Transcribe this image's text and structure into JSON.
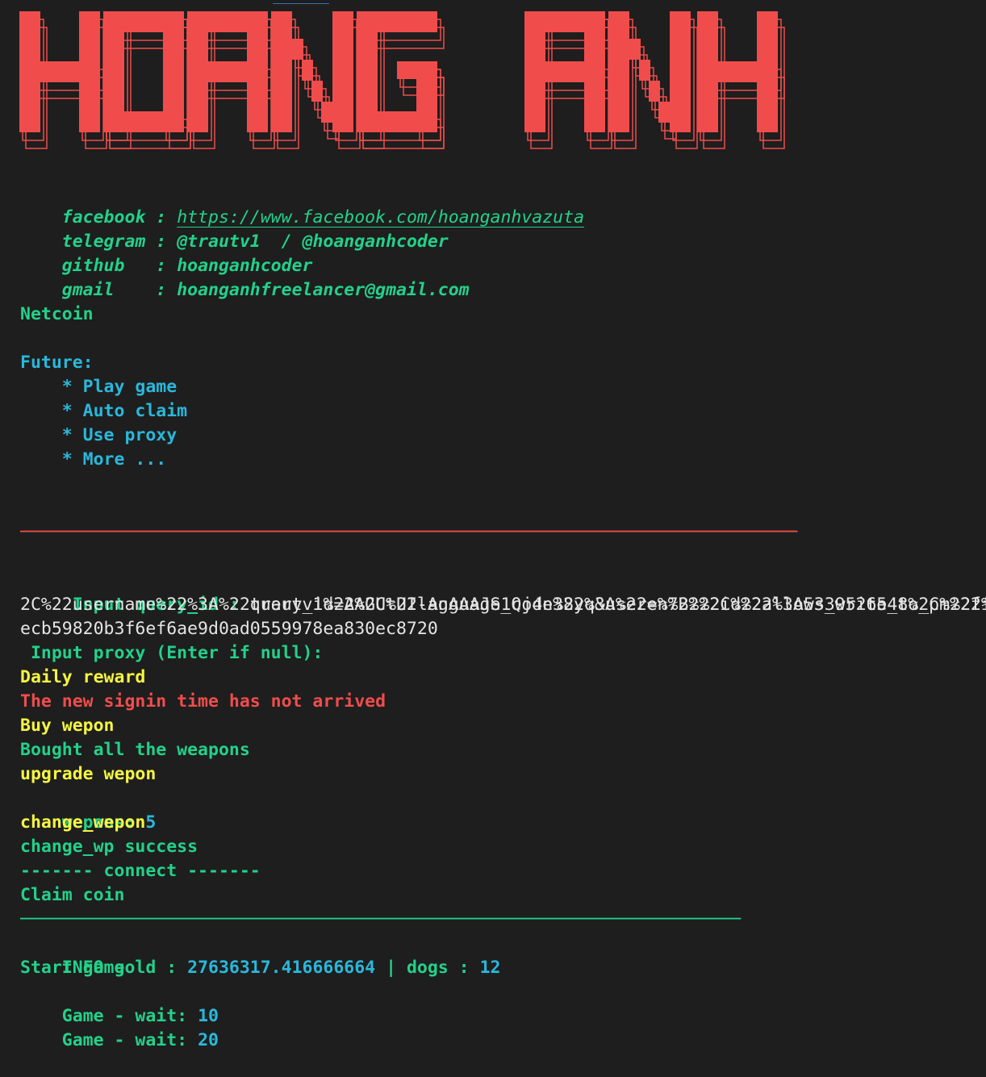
{
  "banner": {
    "text": "HOANG ANH",
    "color": "#f14c4c"
  },
  "contacts": [
    {
      "key": "facebook",
      "sep": " : ",
      "value": "https://www.facebook.com/hoanganhvazuta"
    },
    {
      "key": "telegram",
      "sep": " : ",
      "value": "@trautv1  / @hoanganhcoder"
    },
    {
      "key": "github  ",
      "sep": " : ",
      "value": "hoanganhcoder"
    },
    {
      "key": "gmail   ",
      "sep": " : ",
      "value": "hoanganhfreelancer@gmail.com"
    }
  ],
  "app_name": "Netcoin",
  "future": {
    "heading": "Future:",
    "items": [
      "    * Play game",
      "    * Auto claim",
      "    * Use proxy",
      "    * More ..."
    ]
  },
  "separator_top": "───────────────────────────────────────────────────────────────────────────",
  "input_query": {
    "label": " Input query_id : ",
    "line1": "query_id=AAGUtUI-AgAAAJS1Qj4n38yq&user=%7B%22id%22%3A5339526548%2C%22first_",
    "line2": "2C%22username%22%3A%22trautv1%22%2C%22language_code%22%3A%22en%22%2C%22allows_write_to_pm%22%",
    "line3": "ecb59820b3f6ef6ae9d0ad0559978ea830ec8720"
  },
  "input_proxy": " Input proxy (Enter if null):",
  "log": {
    "daily_reward": "Daily reward",
    "signin_not_arrived": "The new signin time has not arrived",
    "buy_wepon": "Buy wepon",
    "bought_all": "Bought all the weapons",
    "upgrade_wepon": "upgrade wepon",
    "wepons_label": "wepons: ",
    "wepons_value": "5",
    "change_wepon": "change_wepon",
    "change_success": "change_wp success",
    "connect": "------- connect -------",
    "claim_coin": "Claim coin",
    "separator": "─────────────────────────────────────────────────────────────────────",
    "info_gold_label": "INFO gold : ",
    "info_gold_value": "27636317.416666664",
    "info_dogs_sep": " | dogs : ",
    "info_dogs_value": "12",
    "start_game": "Start game",
    "wait1_label": "Game - wait: ",
    "wait1_value": "10",
    "wait2_label": "Game - wait: ",
    "wait2_value": "20"
  }
}
